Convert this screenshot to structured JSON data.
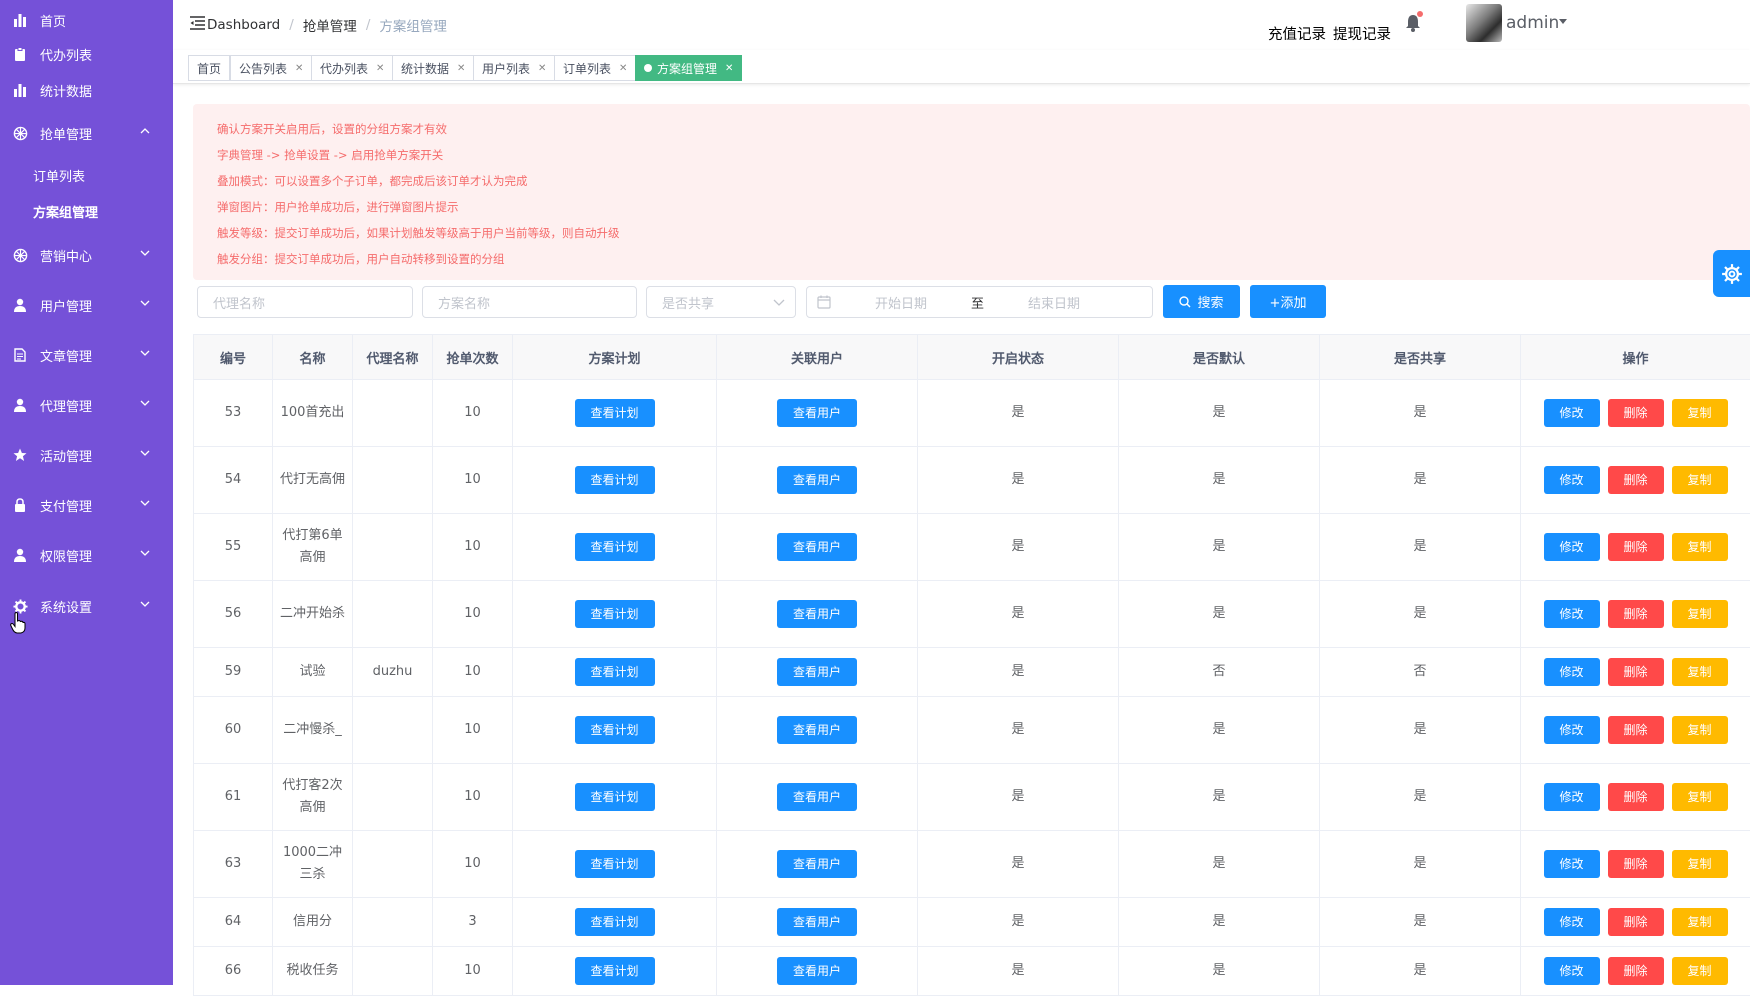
{
  "sidebar": {
    "items": [
      {
        "label": "首页",
        "icon": "bar-chart-icon"
      },
      {
        "label": "代办列表",
        "icon": "clipboard-icon"
      },
      {
        "label": "统计数据",
        "icon": "bar-chart-icon"
      },
      {
        "label": "抢单管理",
        "icon": "aperture-icon"
      },
      {
        "label": "营销中心",
        "icon": "aperture-icon"
      },
      {
        "label": "用户管理",
        "icon": "user-icon"
      },
      {
        "label": "文章管理",
        "icon": "document-icon"
      },
      {
        "label": "代理管理",
        "icon": "user-icon"
      },
      {
        "label": "活动管理",
        "icon": "star-icon"
      },
      {
        "label": "支付管理",
        "icon": "lock-icon"
      },
      {
        "label": "权限管理",
        "icon": "user-icon"
      },
      {
        "label": "系统设置",
        "icon": "gear-icon"
      }
    ],
    "sub_items": [
      {
        "label": "订单列表"
      },
      {
        "label": "方案组管理"
      }
    ]
  },
  "header": {
    "breadcrumb": [
      "Dashboard",
      "抢单管理",
      "方案组管理"
    ],
    "links": [
      "充值记录",
      "提现记录"
    ],
    "username": "admin"
  },
  "tags": [
    {
      "label": "首页"
    },
    {
      "label": "公告列表"
    },
    {
      "label": "代办列表"
    },
    {
      "label": "统计数据"
    },
    {
      "label": "用户列表"
    },
    {
      "label": "订单列表"
    },
    {
      "label": "方案组管理"
    }
  ],
  "notice": [
    "确认方案开关启用后，设置的分组方案才有效",
    "字典管理 -> 抢单设置 -> 启用抢单方案开关",
    "叠加模式：可以设置多个子订单，都完成后该订单才认为完成",
    "弹窗图片：用户抢单成功后，进行弹窗图片提示",
    "触发等级：提交订单成功后，如果计划触发等级高于用户当前等级，则自动升级",
    "触发分组：提交订单成功后，用户自动转移到设置的分组"
  ],
  "filters": {
    "agent_placeholder": "代理名称",
    "plan_placeholder": "方案名称",
    "share_placeholder": "是否共享",
    "start_placeholder": "开始日期",
    "range_sep": "至",
    "end_placeholder": "结束日期",
    "search_label": "搜索",
    "add_label": "+添加"
  },
  "table": {
    "headers": [
      "编号",
      "名称",
      "代理名称",
      "抢单次数",
      "方案计划",
      "关联用户",
      "开启状态",
      "是否默认",
      "是否共享",
      "操作"
    ],
    "view_plan_label": "查看计划",
    "view_user_label": "查看用户",
    "edit_label": "修改",
    "delete_label": "删除",
    "copy_label": "复制",
    "rows": [
      {
        "id": "53",
        "name": "100首充出",
        "agent": "",
        "count": "10",
        "enabled": "是",
        "default": "是",
        "shared": "是"
      },
      {
        "id": "54",
        "name": "代打无高佣",
        "agent": "",
        "count": "10",
        "enabled": "是",
        "default": "是",
        "shared": "是"
      },
      {
        "id": "55",
        "name": "代打第6单高佣",
        "agent": "",
        "count": "10",
        "enabled": "是",
        "default": "是",
        "shared": "是"
      },
      {
        "id": "56",
        "name": "二冲开始杀",
        "agent": "",
        "count": "10",
        "enabled": "是",
        "default": "是",
        "shared": "是"
      },
      {
        "id": "59",
        "name": "试验",
        "agent": "duzhu",
        "count": "10",
        "enabled": "是",
        "default": "否",
        "shared": "否"
      },
      {
        "id": "60",
        "name": "二冲慢杀_",
        "agent": "",
        "count": "10",
        "enabled": "是",
        "default": "是",
        "shared": "是"
      },
      {
        "id": "61",
        "name": "代打客2次高佣",
        "agent": "",
        "count": "10",
        "enabled": "是",
        "default": "是",
        "shared": "是"
      },
      {
        "id": "63",
        "name": "1000二冲三杀",
        "agent": "",
        "count": "10",
        "enabled": "是",
        "default": "是",
        "shared": "是"
      },
      {
        "id": "64",
        "name": "信用分",
        "agent": "",
        "count": "3",
        "enabled": "是",
        "default": "是",
        "shared": "是"
      },
      {
        "id": "66",
        "name": "税收任务",
        "agent": "",
        "count": "10",
        "enabled": "是",
        "default": "是",
        "shared": "是"
      }
    ]
  }
}
